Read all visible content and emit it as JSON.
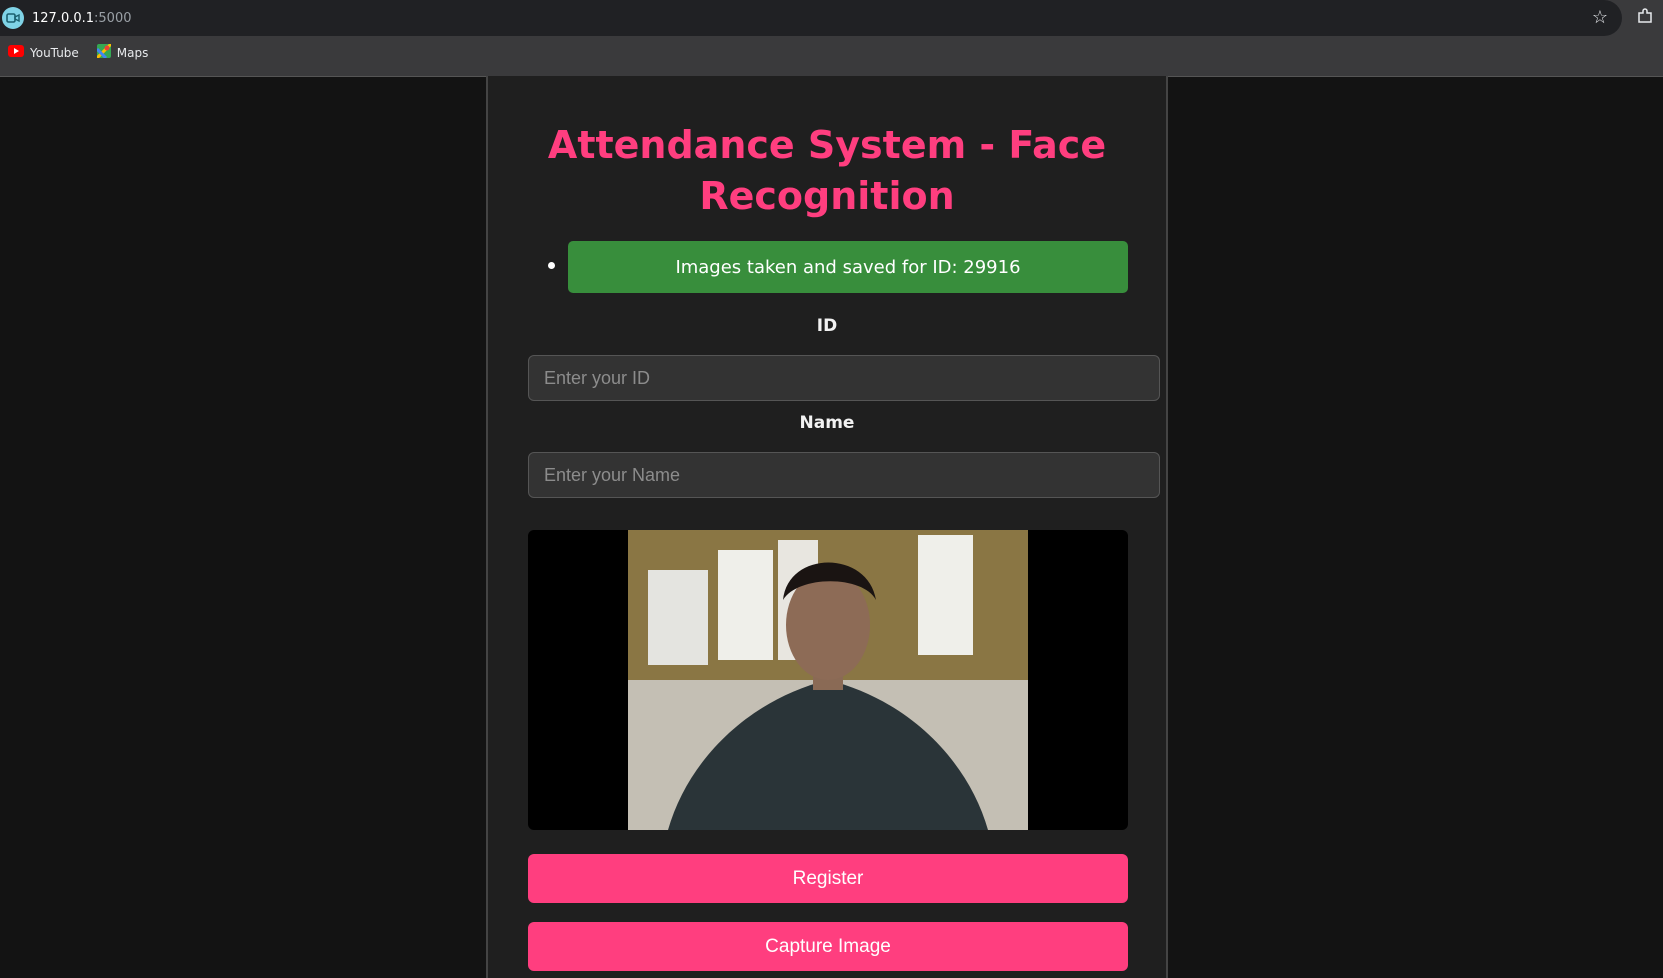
{
  "browser": {
    "url_host": "127.0.0.1",
    "url_port": ":5000",
    "bookmarks": [
      {
        "label": "YouTube",
        "icon": "youtube-icon"
      },
      {
        "label": "Maps",
        "icon": "maps-icon"
      }
    ]
  },
  "page": {
    "title": "Attendance System - Face Recognition",
    "flash_message": "Images taken and saved for ID: 29916",
    "id_label": "ID",
    "id_placeholder": "Enter your ID",
    "name_label": "Name",
    "name_placeholder": "Enter your Name",
    "register_button": "Register",
    "capture_button": "Capture Image"
  },
  "colors": {
    "accent": "#ff3e7f",
    "success": "#388e3c",
    "background": "#131313",
    "card": "#1f1f1f"
  }
}
